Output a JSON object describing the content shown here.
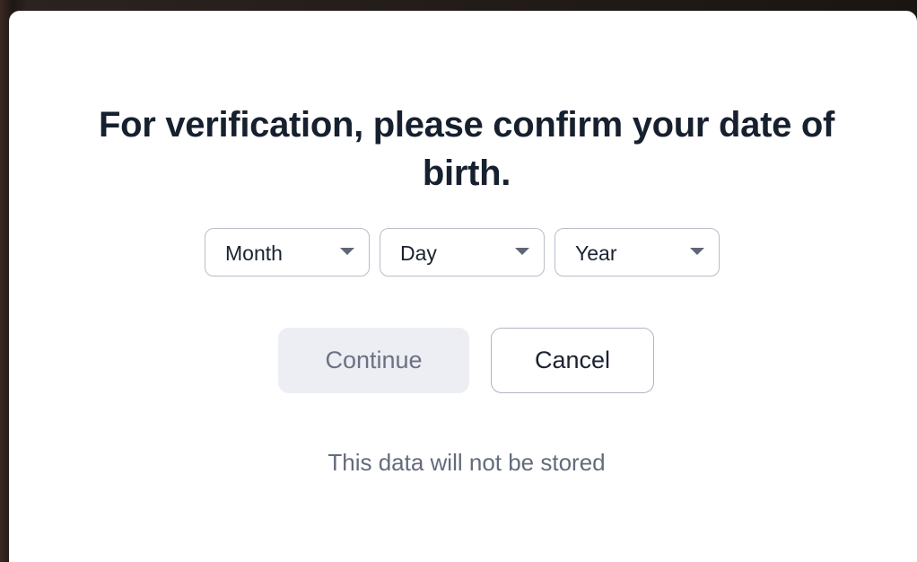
{
  "dialog": {
    "title": "For verification, please confirm your date of birth.",
    "note": "This data will not be stored"
  },
  "date_selects": [
    {
      "label": "Month",
      "icon": "caret-down-icon"
    },
    {
      "label": "Day",
      "icon": "caret-down-icon"
    },
    {
      "label": "Year",
      "icon": "caret-down-icon"
    }
  ],
  "buttons": {
    "continue_label": "Continue",
    "continue_disabled": true,
    "cancel_label": "Cancel"
  },
  "colors": {
    "title": "#17202e",
    "disabled_button_bg": "#eceef4",
    "disabled_button_text": "#6b7282",
    "border": "#b9bdc8",
    "note_text": "#646b7b"
  }
}
